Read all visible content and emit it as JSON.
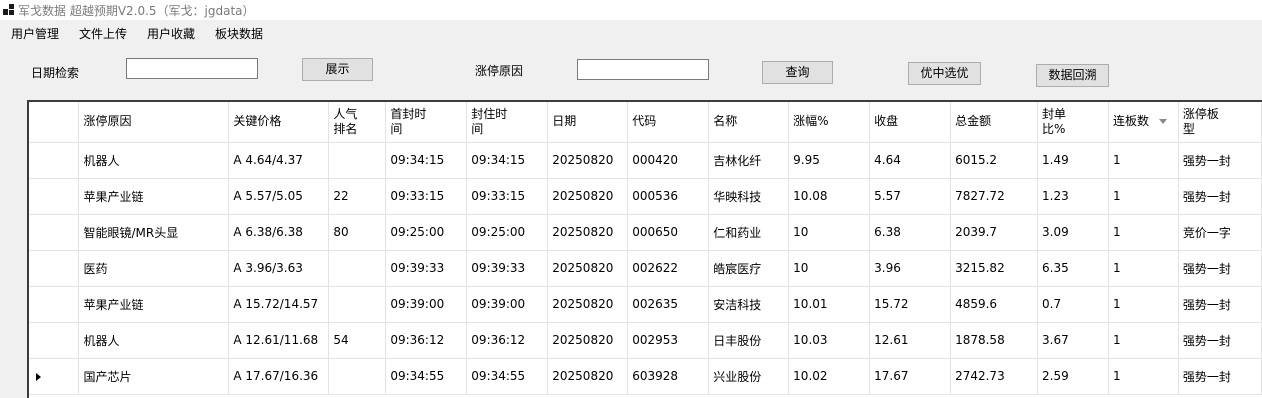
{
  "window": {
    "title": "军戈数据 超越预期V2.0.5（军戈：jgdata）"
  },
  "menu": [
    "用户管理",
    "文件上传",
    "用户收藏",
    "板块数据"
  ],
  "filters": {
    "date_label": "日期检索",
    "date_value": "",
    "show_button": "展示",
    "reason_label": "涨停原因",
    "reason_value": "",
    "query_button": "查询",
    "select_button": "优中选优",
    "backtest_button": "数据回溯"
  },
  "table": {
    "columns": [
      "涨停原因",
      "关键价格",
      "人气排名",
      "首封时间",
      "封住时间",
      "日期",
      "代码",
      "名称",
      "涨幅%",
      "收盘",
      "总金额",
      "封单比%",
      "连板数",
      "涨停板型"
    ],
    "column_labels": [
      [
        "涨停原因"
      ],
      [
        "关键价格"
      ],
      [
        "人气",
        "排名"
      ],
      [
        "首封时",
        "间"
      ],
      [
        "封住时",
        "间"
      ],
      [
        "日期"
      ],
      [
        "代码"
      ],
      [
        "名称"
      ],
      [
        "涨幅%"
      ],
      [
        "收盘"
      ],
      [
        "总金额"
      ],
      [
        "封单",
        "比%"
      ],
      [
        "连板数"
      ],
      [
        "涨停板",
        "型"
      ]
    ],
    "rows": [
      [
        "机器人",
        "A 4.64/4.37",
        "",
        "09:34:15",
        "09:34:15",
        "20250820",
        "000420",
        "吉林化纤",
        "9.95",
        "4.64",
        "6015.2",
        "1.49",
        "1",
        "强势一封"
      ],
      [
        "苹果产业链",
        "A 5.57/5.05",
        "22",
        "09:33:15",
        "09:33:15",
        "20250820",
        "000536",
        "华映科技",
        "10.08",
        "5.57",
        "7827.72",
        "1.23",
        "1",
        "强势一封"
      ],
      [
        "智能眼镜/MR头显",
        "A 6.38/6.38",
        "80",
        "09:25:00",
        "09:25:00",
        "20250820",
        "000650",
        "仁和药业",
        "10",
        "6.38",
        "2039.7",
        "3.09",
        "1",
        "竞价一字"
      ],
      [
        "医药",
        "A 3.96/3.63",
        "",
        "09:39:33",
        "09:39:33",
        "20250820",
        "002622",
        "皓宸医疗",
        "10",
        "3.96",
        "3215.82",
        "6.35",
        "1",
        "强势一封"
      ],
      [
        "苹果产业链",
        "A 15.72/14.57",
        "",
        "09:39:00",
        "09:39:00",
        "20250820",
        "002635",
        "安洁科技",
        "10.01",
        "15.72",
        "4859.6",
        "0.7",
        "1",
        "强势一封"
      ],
      [
        "机器人",
        "A 12.61/11.68",
        "54",
        "09:36:12",
        "09:36:12",
        "20250820",
        "002953",
        "日丰股份",
        "10.03",
        "12.61",
        "1878.58",
        "3.67",
        "1",
        "强势一封"
      ],
      [
        "国产芯片",
        "A 17.67/16.36",
        "",
        "09:34:55",
        "09:34:55",
        "20250820",
        "603928",
        "兴业股份",
        "10.02",
        "17.67",
        "2742.73",
        "2.59",
        "1",
        "强势一封"
      ]
    ],
    "current_row": 6,
    "sorted_column": 12
  }
}
